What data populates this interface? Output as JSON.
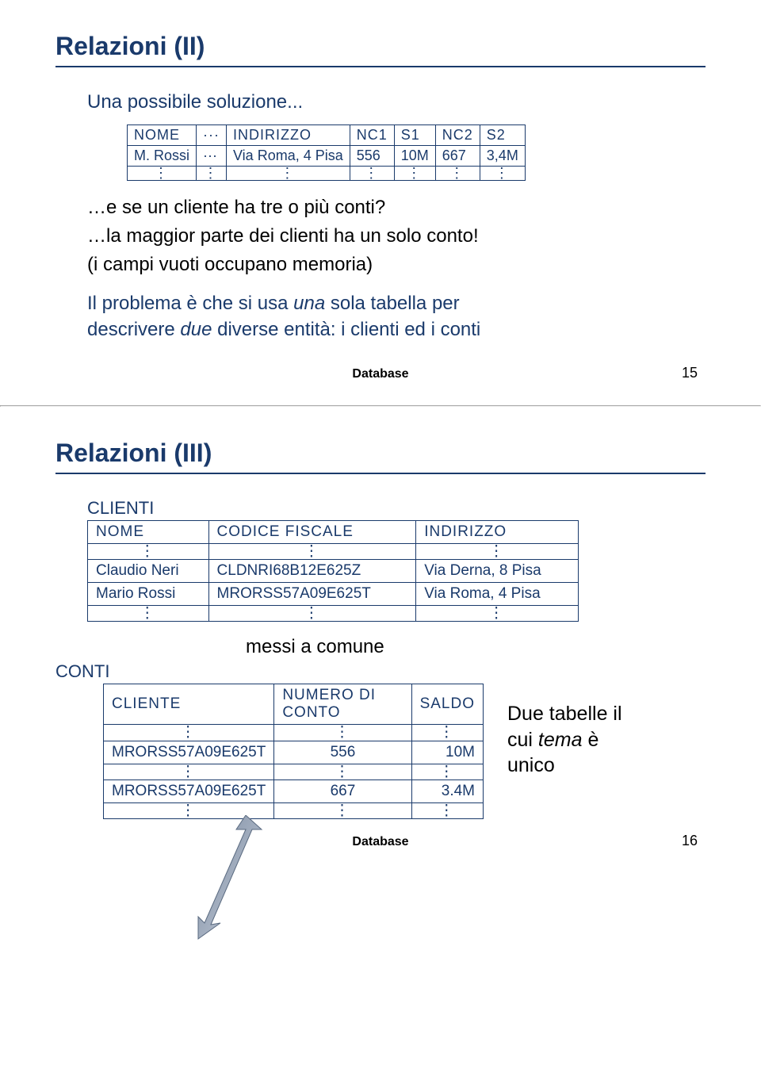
{
  "slide1": {
    "title": "Relazioni (II)",
    "subtitle": "Una possibile soluzione...",
    "flat_table": {
      "headers": [
        "NOME",
        "···",
        "INDIRIZZO",
        "NC1",
        "S1",
        "NC2",
        "S2"
      ],
      "row": [
        "M. Rossi",
        "···",
        "Via Roma, 4 Pisa",
        "556",
        "10M",
        "667",
        "3,4M"
      ]
    },
    "q1": "…e se un cliente ha tre o più conti?",
    "q2": "…la maggior parte dei clienti ha un solo conto!",
    "q3": "(i campi vuoti occupano memoria)",
    "expl_a": "Il problema è che si usa ",
    "expl_b": "una",
    "expl_c": " sola tabella per",
    "expl_d": "descrivere ",
    "expl_e": "due",
    "expl_f": " diverse entità: i clienti ed i conti",
    "footer": "Database",
    "page": "15"
  },
  "slide2": {
    "title": "Relazioni (III)",
    "clienti_label": "CLIENTI",
    "clienti": {
      "headers": [
        "NOME",
        "CODICE FISCALE",
        "INDIRIZZO"
      ],
      "rows": [
        [
          "Claudio Neri",
          "CLDNRI68B12E625Z",
          "Via Derna, 8 Pisa"
        ],
        [
          "Mario Rossi",
          "MRORSS57A09E625T",
          "Via Roma, 4 Pisa"
        ]
      ]
    },
    "messi": "messi a comune",
    "conti_label": "CONTI",
    "conti": {
      "headers": [
        "CLIENTE",
        "NUMERO DI CONTO",
        "SALDO"
      ],
      "rows": [
        [
          "MRORSS57A09E625T",
          "556",
          "10M"
        ],
        [
          "MRORSS57A09E625T",
          "667",
          "3.4M"
        ]
      ]
    },
    "note_a": "Due tabelle il",
    "note_b": "cui ",
    "note_c": "tema",
    "note_d": " è",
    "note_e": "unico",
    "footer": "Database",
    "page": "16"
  },
  "vdots": "⋮"
}
